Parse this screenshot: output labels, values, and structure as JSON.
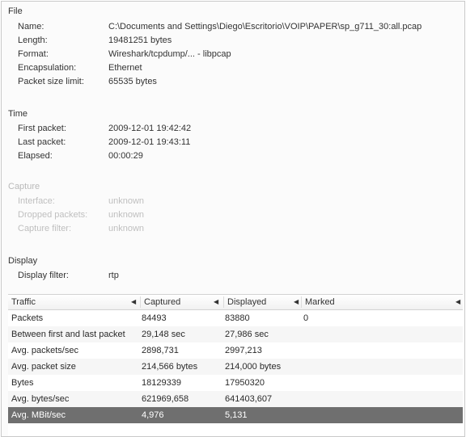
{
  "file": {
    "title": "File",
    "rows": [
      {
        "label": "Name:",
        "value": "C:\\Documents and Settings\\Diego\\Escritorio\\VOIP\\PAPER\\sp_g711_30:all.pcap"
      },
      {
        "label": "Length:",
        "value": "19481251 bytes"
      },
      {
        "label": "Format:",
        "value": "Wireshark/tcpdump/... - libpcap"
      },
      {
        "label": "Encapsulation:",
        "value": "Ethernet"
      },
      {
        "label": "Packet size limit:",
        "value": "65535 bytes"
      }
    ]
  },
  "time": {
    "title": "Time",
    "rows": [
      {
        "label": "First packet:",
        "value": "2009-12-01 19:42:42"
      },
      {
        "label": "Last packet:",
        "value": "2009-12-01 19:43:11"
      },
      {
        "label": "Elapsed:",
        "value": "00:00:29"
      }
    ]
  },
  "capture": {
    "title": "Capture",
    "rows": [
      {
        "label": "Interface:",
        "value": "unknown"
      },
      {
        "label": "Dropped packets:",
        "value": "unknown"
      },
      {
        "label": "Capture filter:",
        "value": "unknown"
      }
    ]
  },
  "display": {
    "title": "Display",
    "rows": [
      {
        "label": "Display filter:",
        "value": "rtp"
      }
    ]
  },
  "table": {
    "columns": [
      "Traffic",
      "Captured",
      "Displayed",
      "Marked"
    ],
    "rows": [
      [
        "Packets",
        "84493",
        "83880",
        "0"
      ],
      [
        "Between first and last packet",
        "29,148 sec",
        "27,986 sec",
        ""
      ],
      [
        "Avg. packets/sec",
        "2898,731",
        "2997,213",
        ""
      ],
      [
        "Avg. packet size",
        "214,566 bytes",
        "214,000 bytes",
        ""
      ],
      [
        "Bytes",
        "18129339",
        "17950320",
        ""
      ],
      [
        "Avg. bytes/sec",
        "621969,658",
        "641403,607",
        ""
      ],
      [
        "Avg. MBit/sec",
        "4,976",
        "5,131",
        ""
      ]
    ],
    "selected_row": 6
  }
}
